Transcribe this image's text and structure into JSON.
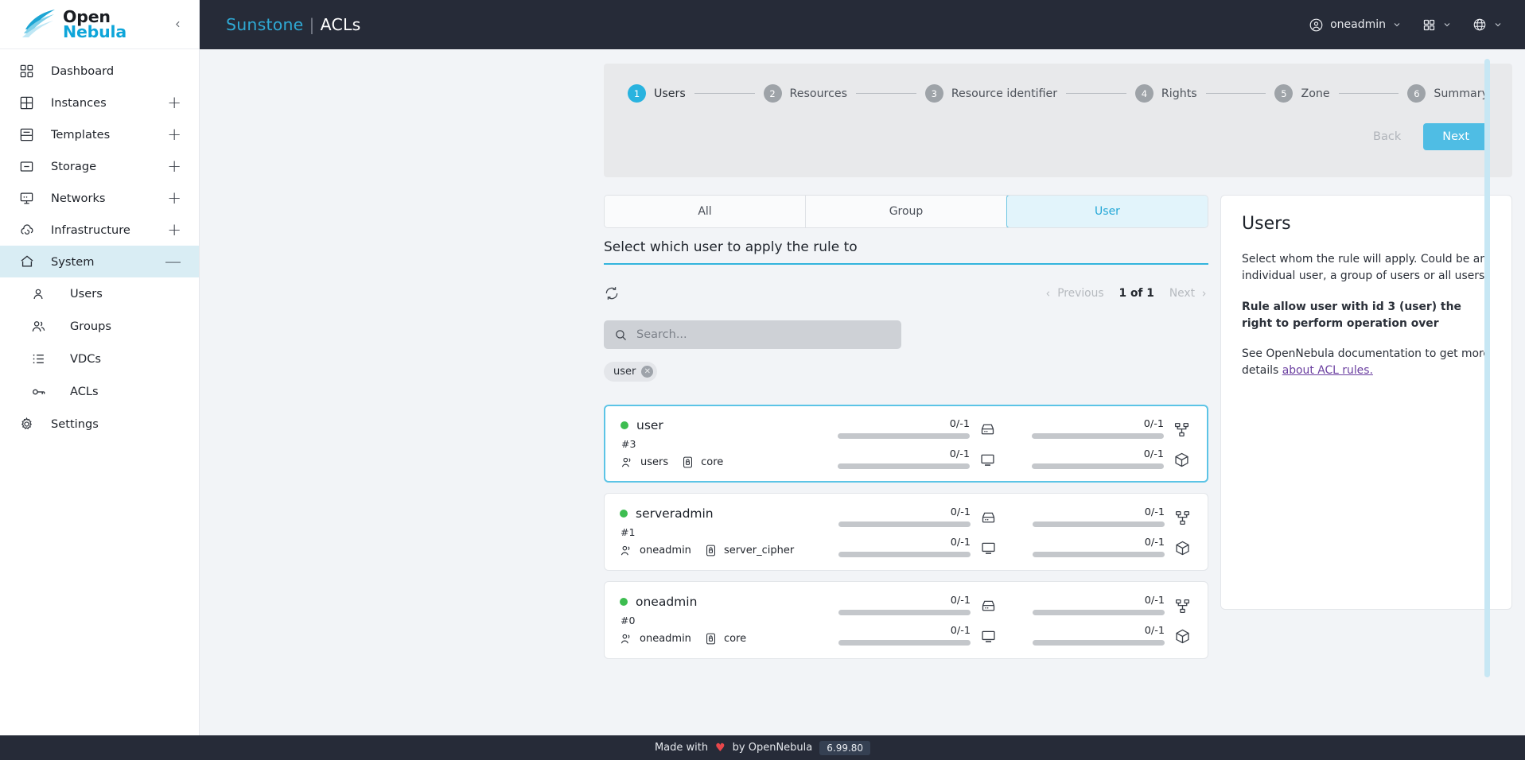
{
  "sidebar": {
    "logo": {
      "part1": "Open",
      "part2": "Nebula"
    },
    "collapse_icon": "chevron-left-icon",
    "items": [
      {
        "label": "Dashboard",
        "icon": "dashboard-icon",
        "expand": ""
      },
      {
        "label": "Instances",
        "icon": "grid-icon",
        "expand": "+"
      },
      {
        "label": "Templates",
        "icon": "template-icon",
        "expand": "+"
      },
      {
        "label": "Storage",
        "icon": "storage-icon",
        "expand": "+"
      },
      {
        "label": "Networks",
        "icon": "network-icon",
        "expand": "+"
      },
      {
        "label": "Infrastructure",
        "icon": "cloud-icon",
        "expand": "+"
      },
      {
        "label": "System",
        "icon": "home-icon",
        "expand": "—",
        "active": true
      }
    ],
    "sub_items": [
      {
        "label": "Users",
        "icon": "user-icon"
      },
      {
        "label": "Groups",
        "icon": "group-icon"
      },
      {
        "label": "VDCs",
        "icon": "list-icon"
      },
      {
        "label": "ACLs",
        "icon": "key-icon"
      }
    ],
    "settings": {
      "label": "Settings",
      "icon": "gear-icon"
    }
  },
  "topbar": {
    "brand_primary": "Sunstone",
    "brand_separator": "|",
    "brand_section": "ACLs",
    "user": "oneadmin",
    "user_icon": "account-circle-icon",
    "apps_icon": "apps-grid-icon",
    "language_icon": "globe-icon"
  },
  "stepper": {
    "steps": [
      {
        "num": "1",
        "label": "Users",
        "active": true
      },
      {
        "num": "2",
        "label": "Resources",
        "active": false
      },
      {
        "num": "3",
        "label": "Resource identifier",
        "active": false
      },
      {
        "num": "4",
        "label": "Rights",
        "active": false
      },
      {
        "num": "5",
        "label": "Zone",
        "active": false
      },
      {
        "num": "6",
        "label": "Summary",
        "active": false
      }
    ],
    "back_label": "Back",
    "next_label": "Next",
    "accent_color": "#29b3df"
  },
  "selector": {
    "tabs": [
      {
        "label": "All",
        "active": false
      },
      {
        "label": "Group",
        "active": false
      },
      {
        "label": "User",
        "active": true
      }
    ],
    "section_title": "Select which user to apply the rule to",
    "refresh_icon": "refresh-icon",
    "pagination": {
      "previous": "Previous",
      "count": "1 of 1",
      "next": "Next"
    },
    "search": {
      "placeholder": "Search...",
      "value": "",
      "icon": "search-icon"
    },
    "chips": [
      {
        "label": "user",
        "remove_icon": "close-icon"
      }
    ]
  },
  "users": [
    {
      "name": "user",
      "id": "#3",
      "group": "users",
      "group_icon": "group-icon",
      "auth": "core",
      "auth_icon": "lock-icon",
      "status": "online",
      "selected": true,
      "metrics": [
        {
          "value": "0/-1",
          "icon": "disk-icon",
          "percent": 0
        },
        {
          "value": "0/-1",
          "icon": "vm-monitor-icon",
          "percent": 0
        },
        {
          "value": "0/-1",
          "icon": "network-tree-icon",
          "percent": 0
        },
        {
          "value": "0/-1",
          "icon": "package-icon",
          "percent": 0
        }
      ]
    },
    {
      "name": "serveradmin",
      "id": "#1",
      "group": "oneadmin",
      "group_icon": "group-icon",
      "auth": "server_cipher",
      "auth_icon": "lock-icon",
      "status": "online",
      "selected": false,
      "metrics": [
        {
          "value": "0/-1",
          "icon": "disk-icon",
          "percent": 0
        },
        {
          "value": "0/-1",
          "icon": "vm-monitor-icon",
          "percent": 0
        },
        {
          "value": "0/-1",
          "icon": "network-tree-icon",
          "percent": 0
        },
        {
          "value": "0/-1",
          "icon": "package-icon",
          "percent": 0
        }
      ]
    },
    {
      "name": "oneadmin",
      "id": "#0",
      "group": "oneadmin",
      "group_icon": "group-icon",
      "auth": "core",
      "auth_icon": "lock-icon",
      "status": "online",
      "selected": false,
      "metrics": [
        {
          "value": "0/-1",
          "icon": "disk-icon",
          "percent": 0
        },
        {
          "value": "0/-1",
          "icon": "vm-monitor-icon",
          "percent": 0
        },
        {
          "value": "0/-1",
          "icon": "network-tree-icon",
          "percent": 0
        },
        {
          "value": "0/-1",
          "icon": "package-icon",
          "percent": 0
        }
      ]
    }
  ],
  "info_panel": {
    "title": "Users",
    "paragraph1": "Select whom the rule will apply. Could be an individual user, a group of users or all users.",
    "paragraph2": "Rule allow user with id 3 (user) the right to perform operation over",
    "paragraph3_prefix": "See OpenNebula documentation to get more details ",
    "paragraph3_link": "about ACL rules."
  },
  "footer": {
    "made_with": "Made with",
    "heart": "♥",
    "by": "by OpenNebula",
    "version": "6.99.80"
  }
}
